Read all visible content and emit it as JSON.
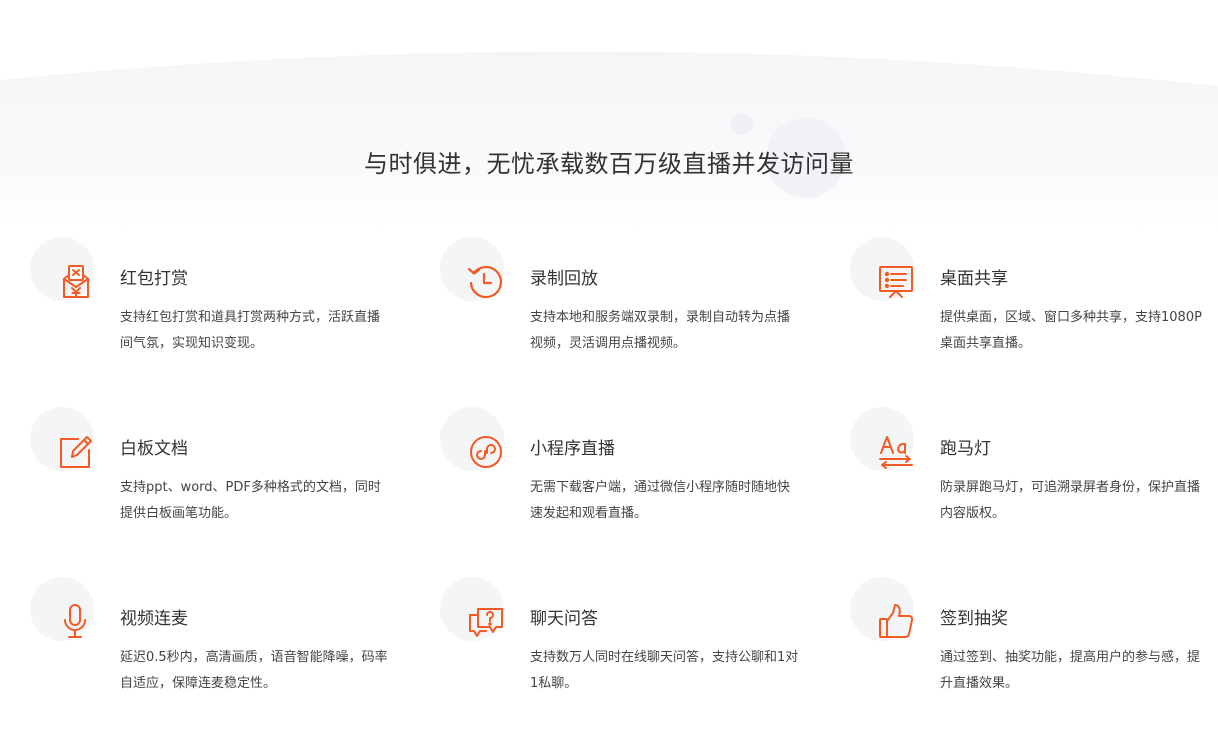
{
  "headline": "与时俱进，无忧承载数百万级直播并发访问量",
  "accent_color": "#f25b24",
  "features": [
    {
      "title": "红包打赏",
      "desc": "支持红包打赏和道具打赏两种方式，活跃直播间气氛，实现知识变现。",
      "icon": "red-envelope-icon"
    },
    {
      "title": "录制回放",
      "desc": "支持本地和服务端双录制，录制自动转为点播视频，灵活调用点播视频。",
      "icon": "replay-clock-icon"
    },
    {
      "title": "桌面共享",
      "desc": "提供桌面，区域、窗口多种共享，支持1080P桌面共享直播。",
      "icon": "presentation-board-icon"
    },
    {
      "title": "白板文档",
      "desc": "支持ppt、word、PDF多种格式的文档，同时提供白板画笔功能。",
      "icon": "whiteboard-edit-icon"
    },
    {
      "title": "小程序直播",
      "desc": "无需下载客户端，通过微信小程序随时随地快速发起和观看直播。",
      "icon": "mini-program-icon"
    },
    {
      "title": "跑马灯",
      "desc": "防录屏跑马灯，可追溯录屏者身份，保护直播内容版权。",
      "icon": "marquee-text-icon"
    },
    {
      "title": "视频连麦",
      "desc": "延迟0.5秒内，高清画质，语音智能降噪，码率自适应，保障连麦稳定性。",
      "icon": "microphone-icon"
    },
    {
      "title": "聊天问答",
      "desc": "支持数万人同时在线聊天问答，支持公聊和1对1私聊。",
      "icon": "chat-question-icon"
    },
    {
      "title": "签到抽奖",
      "desc": "通过签到、抽奖功能，提高用户的参与感，提升直播效果。",
      "icon": "thumbs-up-icon"
    }
  ]
}
